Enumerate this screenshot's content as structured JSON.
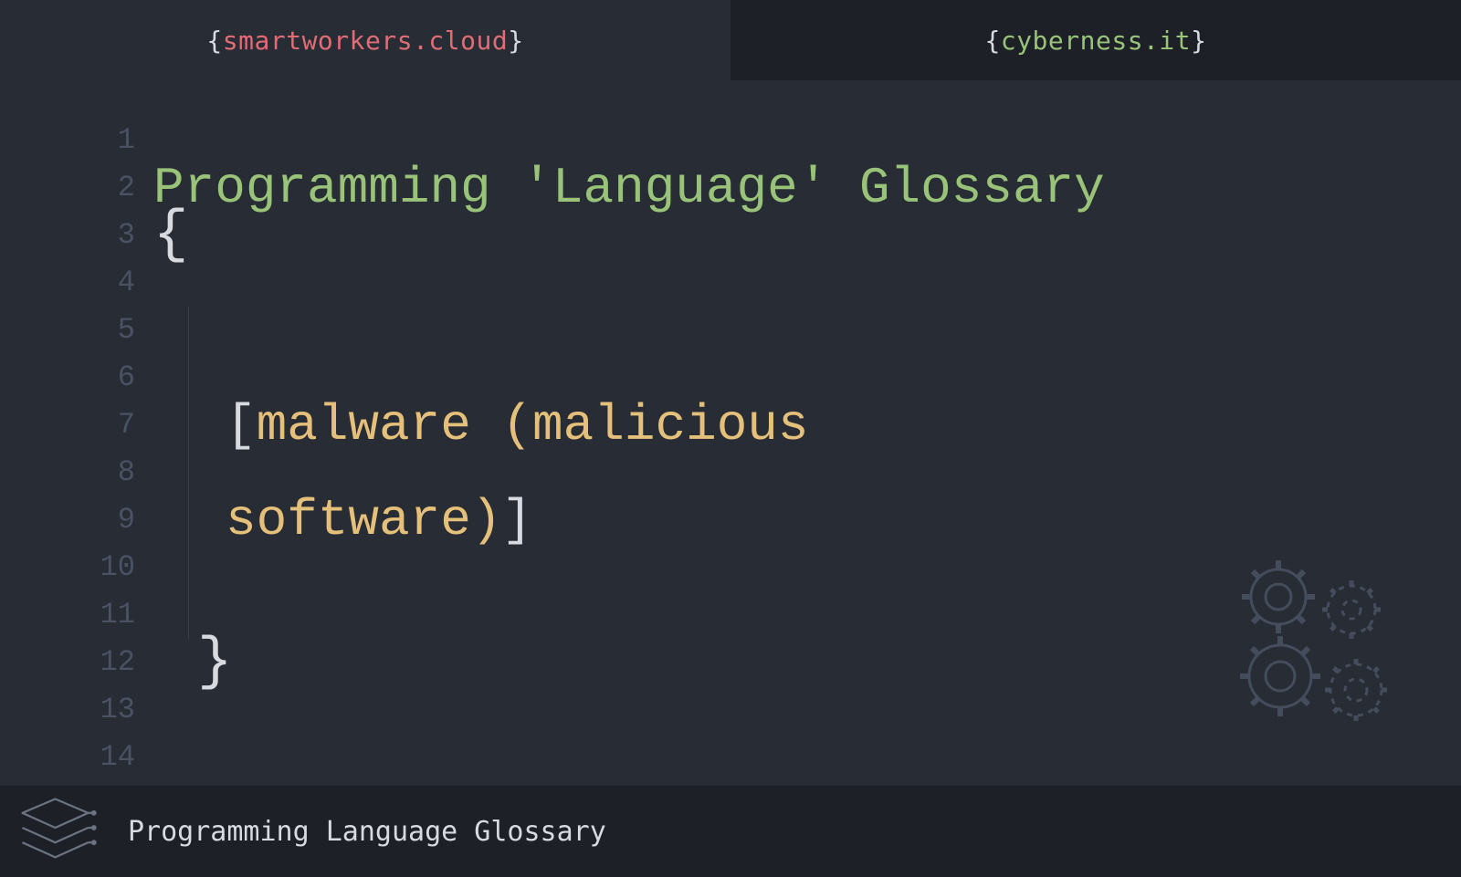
{
  "tabs": {
    "left": "smartworkers.cloud",
    "right": "cyberness.it"
  },
  "lineNumbers": [
    "1",
    "2",
    "3",
    "4",
    "5",
    "6",
    "7",
    "8",
    "9",
    "10",
    "11",
    "12",
    "13",
    "14"
  ],
  "title": "Programming 'Language' Glossary",
  "term_line1": "malware (malicious",
  "term_line2": "software)",
  "footer": "Programming Language Glossary"
}
